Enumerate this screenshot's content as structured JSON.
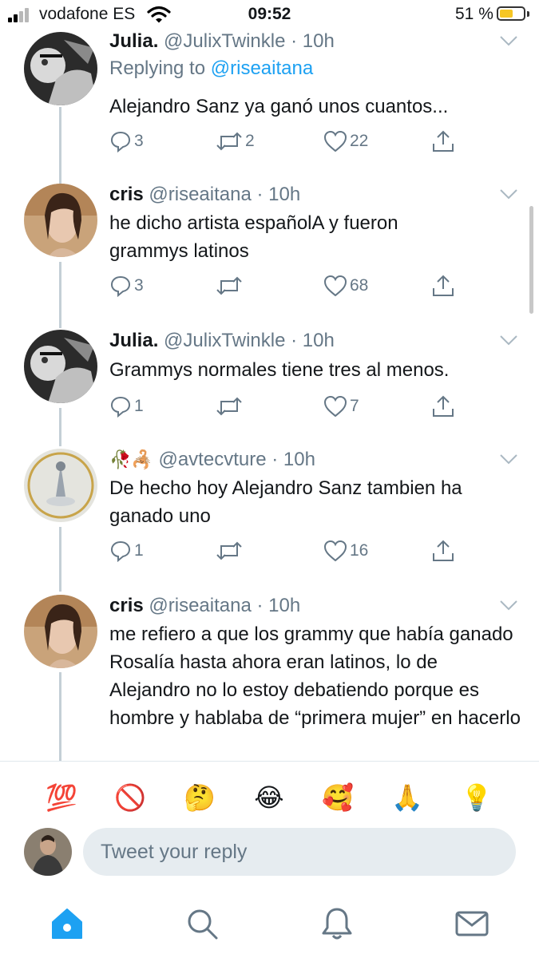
{
  "status_bar": {
    "carrier": "vodafone ES",
    "time": "09:52",
    "battery": "51 %",
    "battery_level": 0.51
  },
  "tweets": [
    {
      "name": "Julia.",
      "handle": "@JulixTwinkle",
      "sep": "·",
      "time": "10h",
      "replying_prefix": "Replying to",
      "replying_to": "@riseaitana",
      "text": "Alejandro Sanz ya ganó unos cuantos...",
      "replies": "3",
      "retweets": "2",
      "likes": "22",
      "avatar": "bw-portrait"
    },
    {
      "name": "cris",
      "handle": "@riseaitana",
      "sep": "·",
      "time": "10h",
      "text": "he dicho artista españolA y fueron grammys latinos",
      "replies": "3",
      "retweets": "",
      "likes": "68",
      "avatar": "portrait-warm"
    },
    {
      "name": "Julia.",
      "handle": "@JulixTwinkle",
      "sep": "·",
      "time": "10h",
      "text": "Grammys normales tiene tres al menos.",
      "replies": "1",
      "retweets": "",
      "likes": "7",
      "avatar": "bw-portrait"
    },
    {
      "name": "🥀🦂",
      "handle": "@avtecvture",
      "sep": "·",
      "time": "10h",
      "text": "De hecho hoy Alejandro Sanz tambien ha ganado uno",
      "replies": "1",
      "retweets": "",
      "likes": "16",
      "avatar": "album-art"
    },
    {
      "name": "cris",
      "handle": "@riseaitana",
      "sep": "·",
      "time": "10h",
      "text": "me refiero a que los grammy que había ganado Rosalía hasta ahora eran latinos, lo de Alejandro no lo estoy debatiendo porque es hombre y hablaba de “primera mujer” en hacerlo",
      "avatar": "portrait-warm"
    }
  ],
  "emoji_bar": [
    "💯",
    "🚫",
    "🤔",
    "😂",
    "🥰",
    "🙏",
    "💡"
  ],
  "reply_box": {
    "placeholder": "Tweet your reply"
  },
  "tab_bar": [
    "home-icon",
    "search-icon",
    "notifications-icon",
    "messages-icon"
  ],
  "colors": {
    "accent": "#1da1f2",
    "muted": "#657786",
    "text": "#14171a",
    "battery": "#f6c624"
  }
}
